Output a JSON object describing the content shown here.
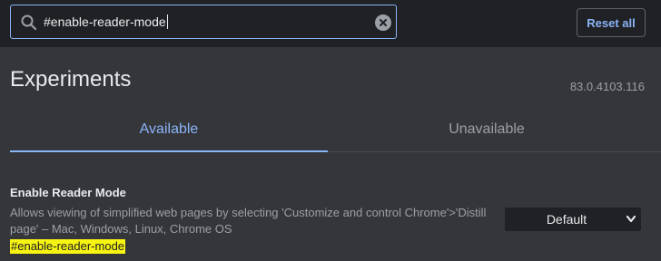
{
  "search": {
    "value": "#enable-reader-mode",
    "icon": "search-icon",
    "clear_icon": "clear-icon"
  },
  "toolbar": {
    "reset_label": "Reset all"
  },
  "page": {
    "title": "Experiments",
    "version": "83.0.4103.116"
  },
  "tabs": [
    {
      "label": "Available",
      "active": true
    },
    {
      "label": "Unavailable",
      "active": false
    }
  ],
  "experiment": {
    "name": "Enable Reader Mode",
    "description": "Allows viewing of simplified web pages by selecting 'Customize and control Chrome'>'Distill page' – Mac, Windows, Linux, Chrome OS",
    "link": "#enable-reader-mode",
    "selected_option": "Default"
  },
  "colors": {
    "accent": "#8ab4f8",
    "highlight": "#f7f312",
    "background": "#35363a",
    "header_background": "#202124"
  }
}
